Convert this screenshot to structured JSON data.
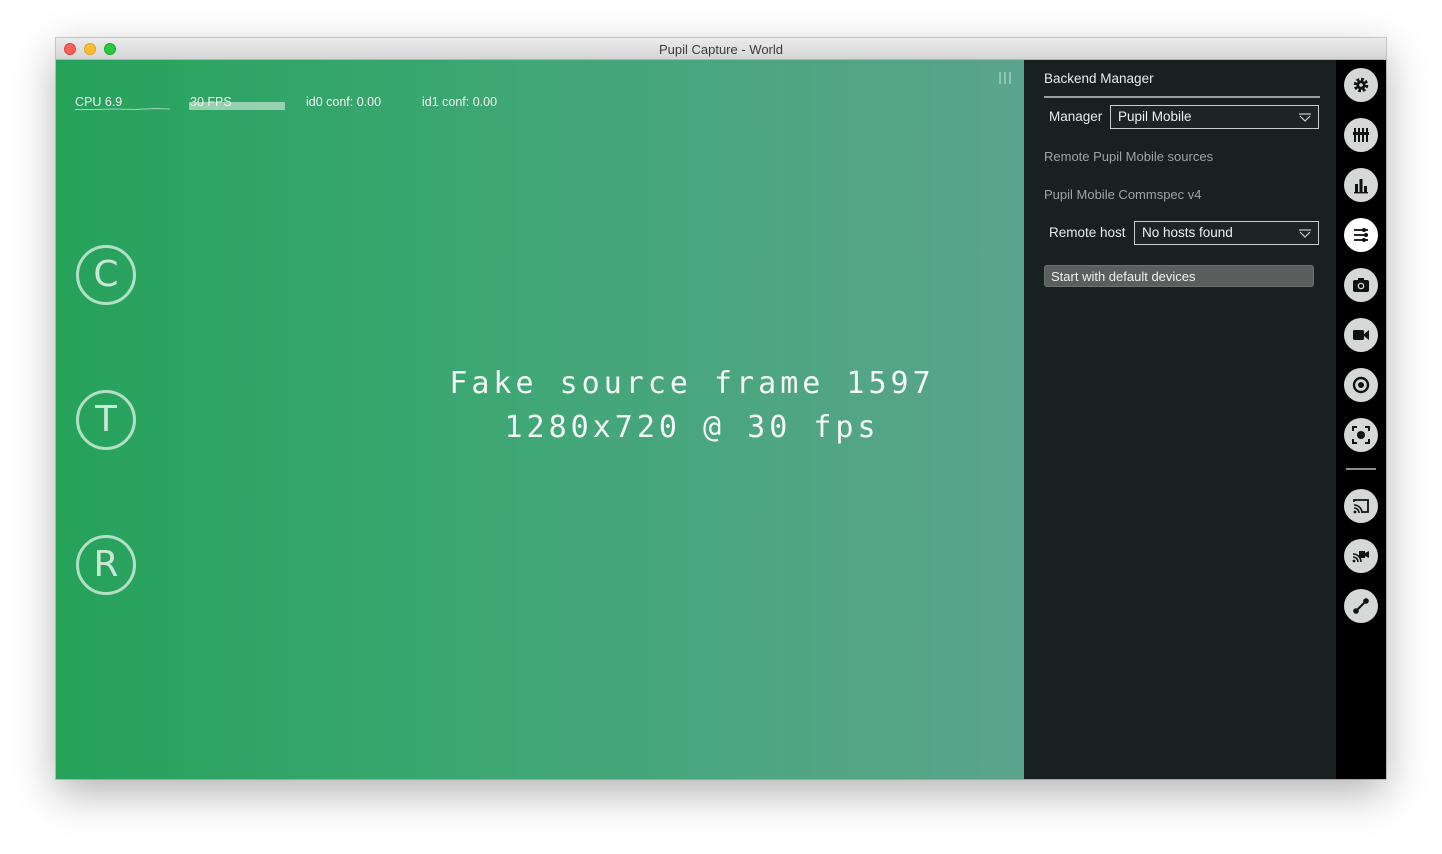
{
  "window": {
    "title": "Pupil Capture - World"
  },
  "hud": {
    "cpu_label": "CPU 6.9",
    "fps_label": "30 FPS",
    "id0_label": "id0 conf: 0.00",
    "id1_label": "id1 conf: 0.00"
  },
  "quick_buttons": {
    "calibrate": "C",
    "test": "T",
    "record": "R"
  },
  "frame_overlay": {
    "line1": "Fake source frame 1597",
    "line2": "1280x720 @ 30 fps"
  },
  "backend_manager": {
    "title": "Backend Manager",
    "manager_label": "Manager",
    "manager_value": "Pupil Mobile",
    "sources_text": "Remote Pupil Mobile sources",
    "commspec_text": "Pupil Mobile Commspec v4",
    "remote_host_label": "Remote host",
    "remote_host_value": "No hosts found",
    "start_button": "Start with default devices"
  },
  "menu_icons": [
    "gear-icon",
    "equalizer-icon",
    "bar-chart-icon",
    "backend-manager-icon",
    "camera-icon",
    "video-camera-icon",
    "record-target-icon",
    "screen-capture-icon",
    "cast-icon",
    "cast-video-icon",
    "pipeline-icon"
  ],
  "colors": {
    "viewport_left": "#25a25a",
    "viewport_right": "#5ba48d",
    "panel_bg": "#182020",
    "icon_bar_bg": "#000000"
  }
}
